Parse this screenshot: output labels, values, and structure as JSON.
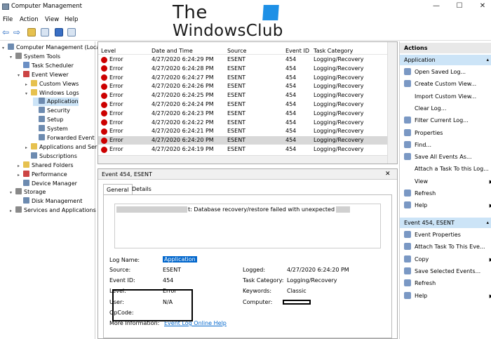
{
  "window": {
    "title": "Computer Management"
  },
  "menu": [
    "File",
    "Action",
    "View",
    "Help"
  ],
  "watermark": {
    "line1": "The",
    "line2": "WindowsClub"
  },
  "tree": {
    "items": [
      {
        "label": "Computer Management (Local)",
        "level": 0,
        "icon": "computer-icon"
      },
      {
        "label": "System Tools",
        "level": 1,
        "icon": "tools-icon"
      },
      {
        "label": "Task Scheduler",
        "level": 2,
        "icon": "clock-icon"
      },
      {
        "label": "Event Viewer",
        "level": 2,
        "icon": "event-viewer-icon"
      },
      {
        "label": "Custom Views",
        "level": 3,
        "icon": "folder-icon"
      },
      {
        "label": "Windows Logs",
        "level": 3,
        "icon": "folder-icon"
      },
      {
        "label": "Application",
        "level": 4,
        "icon": "log-icon"
      },
      {
        "label": "Security",
        "level": 4,
        "icon": "log-icon"
      },
      {
        "label": "Setup",
        "level": 4,
        "icon": "log-icon"
      },
      {
        "label": "System",
        "level": 4,
        "icon": "log-icon"
      },
      {
        "label": "Forwarded Event",
        "level": 4,
        "icon": "log-icon"
      },
      {
        "label": "Applications and Ser",
        "level": 3,
        "icon": "folder-icon"
      },
      {
        "label": "Subscriptions",
        "level": 3,
        "icon": "subscriptions-icon"
      },
      {
        "label": "Shared Folders",
        "level": 2,
        "icon": "shared-folder-icon"
      },
      {
        "label": "Performance",
        "level": 2,
        "icon": "performance-icon"
      },
      {
        "label": "Device Manager",
        "level": 2,
        "icon": "device-manager-icon"
      },
      {
        "label": "Storage",
        "level": 1,
        "icon": "storage-icon"
      },
      {
        "label": "Disk Management",
        "level": 2,
        "icon": "disk-icon"
      },
      {
        "label": "Services and Applications",
        "level": 1,
        "icon": "services-icon"
      }
    ]
  },
  "list": {
    "headers": [
      "Level",
      "Date and Time",
      "Source",
      "Event ID",
      "Task Category"
    ],
    "rows": [
      [
        "Error",
        "4/27/2020 6:24:29 PM",
        "ESENT",
        "454",
        "Logging/Recovery"
      ],
      [
        "Error",
        "4/27/2020 6:24:28 PM",
        "ESENT",
        "454",
        "Logging/Recovery"
      ],
      [
        "Error",
        "4/27/2020 6:24:27 PM",
        "ESENT",
        "454",
        "Logging/Recovery"
      ],
      [
        "Error",
        "4/27/2020 6:24:26 PM",
        "ESENT",
        "454",
        "Logging/Recovery"
      ],
      [
        "Error",
        "4/27/2020 6:24:25 PM",
        "ESENT",
        "454",
        "Logging/Recovery"
      ],
      [
        "Error",
        "4/27/2020 6:24:24 PM",
        "ESENT",
        "454",
        "Logging/Recovery"
      ],
      [
        "Error",
        "4/27/2020 6:24:23 PM",
        "ESENT",
        "454",
        "Logging/Recovery"
      ],
      [
        "Error",
        "4/27/2020 6:24:22 PM",
        "ESENT",
        "454",
        "Logging/Recovery"
      ],
      [
        "Error",
        "4/27/2020 6:24:21 PM",
        "ESENT",
        "454",
        "Logging/Recovery"
      ],
      [
        "Error",
        "4/27/2020 6:24:20 PM",
        "ESENT",
        "454",
        "Logging/Recovery"
      ],
      [
        "Error",
        "4/27/2020 6:24:19 PM",
        "ESENT",
        "454",
        "Logging/Recovery"
      ]
    ]
  },
  "detail": {
    "header": "Event 454, ESENT",
    "close": "✕",
    "tabs": [
      "General",
      "Details"
    ],
    "message": "t: Database recovery/restore failed with unexpected error",
    "fields": {
      "log_name_label": "Log Name:",
      "log_name": "Application",
      "source_label": "Source:",
      "source": "ESENT",
      "event_id_label": "Event ID:",
      "event_id": "454",
      "level_label": "Level:",
      "level": "Error",
      "user_label": "User:",
      "user": "N/A",
      "opcode_label": "OpCode:",
      "more_info_label": "More Information:",
      "more_info_link": "Event Log Online Help",
      "logged_label": "Logged:",
      "logged": "4/27/2020 6:24:20 PM",
      "task_category_label": "Task Category:",
      "task_category": "Logging/Recovery",
      "keywords_label": "Keywords:",
      "keywords": "Classic",
      "computer_label": "Computer:"
    }
  },
  "actions": {
    "title": "Actions",
    "section1": "Application",
    "items1": [
      {
        "label": "Open Saved Log...",
        "icon": "open-log-icon"
      },
      {
        "label": "Create Custom View...",
        "icon": "create-view-icon"
      },
      {
        "label": "Import Custom View...",
        "icon": ""
      },
      {
        "label": "Clear Log...",
        "icon": ""
      },
      {
        "label": "Filter Current Log...",
        "icon": "filter-icon"
      },
      {
        "label": "Properties",
        "icon": "properties-icon"
      },
      {
        "label": "Find...",
        "icon": "find-icon"
      },
      {
        "label": "Save All Events As...",
        "icon": "save-icon"
      },
      {
        "label": "Attach a Task To this Log...",
        "icon": ""
      },
      {
        "label": "View",
        "icon": "",
        "submenu": true
      },
      {
        "label": "Refresh",
        "icon": "refresh-icon"
      },
      {
        "label": "Help",
        "icon": "help-icon",
        "submenu": true
      }
    ],
    "section2": "Event 454, ESENT",
    "items2": [
      {
        "label": "Event Properties",
        "icon": "properties-icon"
      },
      {
        "label": "Attach Task To This Eve...",
        "icon": "attach-task-icon"
      },
      {
        "label": "Copy",
        "icon": "copy-icon",
        "submenu": true
      },
      {
        "label": "Save Selected Events...",
        "icon": "save-icon"
      },
      {
        "label": "Refresh",
        "icon": "refresh-icon"
      },
      {
        "label": "Help",
        "icon": "help-icon",
        "submenu": true
      }
    ]
  },
  "colors": {
    "error_icon": "#cc0000",
    "selection": "#cce4f7",
    "highlight_link": "#0066cc",
    "watermark_logo": "#1e90e6"
  }
}
